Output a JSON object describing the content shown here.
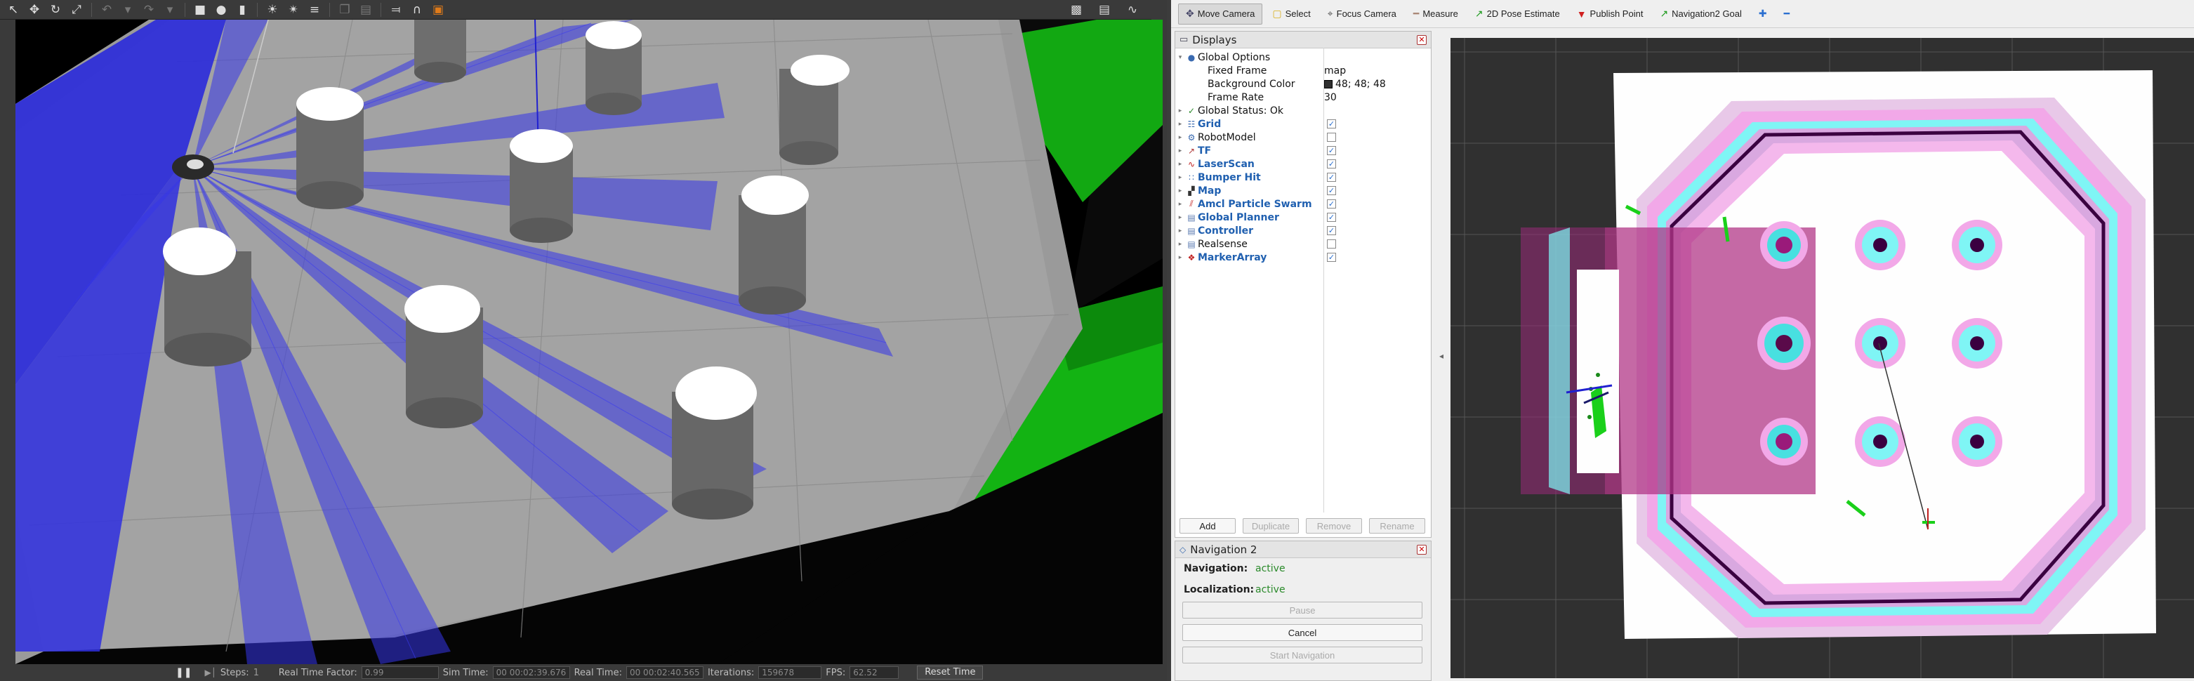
{
  "gazebo": {
    "toolbar_icons": [
      "select-arrow-icon",
      "translate-icon",
      "rotate-icon",
      "scale-icon",
      "undo-icon",
      "undo-history-icon",
      "redo-icon",
      "redo-history-icon",
      "box-icon",
      "sphere-icon",
      "cylinder-icon",
      "point-light-icon",
      "spot-light-icon",
      "directional-light-icon",
      "copy-icon",
      "paste-icon",
      "align-icon",
      "snap-icon",
      "change-view-icon",
      "screenshot-icon",
      "log-icon",
      "plot-icon"
    ],
    "status_bar": {
      "pause_icon": "pause-icon",
      "steps_label": "Steps:",
      "steps_value": "1",
      "rtf_label": "Real Time Factor:",
      "rtf_value": "0.99",
      "sim_time_label": "Sim Time:",
      "sim_time_value": "00 00:02:39.676",
      "real_time_label": "Real Time:",
      "real_time_value": "00 00:02:40.565",
      "iterations_label": "Iterations:",
      "iterations_value": "159678",
      "fps_label": "FPS:",
      "fps_value": "62.52",
      "reset_label": "Reset Time"
    }
  },
  "rviz": {
    "tools": [
      {
        "label": "Move Camera",
        "icon": "move-camera-icon",
        "active": true
      },
      {
        "label": "Select",
        "icon": "select-icon"
      },
      {
        "label": "Focus Camera",
        "icon": "focus-camera-icon"
      },
      {
        "label": "Measure",
        "icon": "measure-icon"
      },
      {
        "label": "2D Pose Estimate",
        "icon": "pose-estimate-icon"
      },
      {
        "label": "Publish Point",
        "icon": "publish-point-icon"
      },
      {
        "label": "Navigation2 Goal",
        "icon": "nav-goal-icon"
      }
    ],
    "displays_panel": {
      "title": "Displays",
      "global_options": {
        "label": "Global Options",
        "fixed_frame_label": "Fixed Frame",
        "fixed_frame_value": "map",
        "bg_color_label": "Background Color",
        "bg_color_value": "48; 48; 48",
        "bg_color_swatch": "#303030",
        "frame_rate_label": "Frame Rate",
        "frame_rate_value": "30"
      },
      "global_status": "Global Status: Ok",
      "displays": [
        {
          "name": "Grid",
          "icon": "grid-icon",
          "checked": true
        },
        {
          "name": "RobotModel",
          "icon": "robot-model-icon",
          "checked": false
        },
        {
          "name": "TF",
          "icon": "tf-icon",
          "checked": true
        },
        {
          "name": "LaserScan",
          "icon": "laser-scan-icon",
          "checked": true
        },
        {
          "name": "Bumper Hit",
          "icon": "bumper-hit-icon",
          "checked": true
        },
        {
          "name": "Map",
          "icon": "map-icon",
          "checked": true
        },
        {
          "name": "Amcl Particle Swarm",
          "icon": "particle-swarm-icon",
          "checked": true
        },
        {
          "name": "Global Planner",
          "icon": "folder-icon",
          "checked": true
        },
        {
          "name": "Controller",
          "icon": "folder-icon",
          "checked": true
        },
        {
          "name": "Realsense",
          "icon": "folder-icon",
          "checked": false
        },
        {
          "name": "MarkerArray",
          "icon": "marker-array-icon",
          "checked": true
        }
      ],
      "buttons": {
        "add": "Add",
        "duplicate": "Duplicate",
        "remove": "Remove",
        "rename": "Rename"
      }
    },
    "nav_panel": {
      "title": "Navigation 2",
      "navigation_label": "Navigation:",
      "navigation_value": "active",
      "localization_label": "Localization:",
      "localization_value": "active",
      "pause_label": "Pause",
      "cancel_label": "Cancel",
      "start_label": "Start Navigation"
    }
  }
}
